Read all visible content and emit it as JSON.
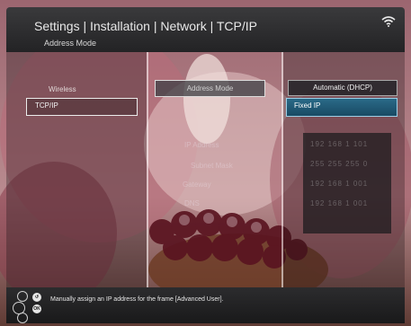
{
  "header": {
    "title": "Settings | Installation | Network | TCP/IP",
    "subtitle": "Address Mode",
    "status_icon": "wifi-icon"
  },
  "column1": {
    "items": [
      {
        "label": "Wireless"
      },
      {
        "label": "TCP/IP",
        "selected": true
      }
    ]
  },
  "column2": {
    "header_label": "Address Mode",
    "field_labels": [
      "IP Address",
      "Subnet Mask",
      "Gateway",
      "DNS"
    ]
  },
  "column3": {
    "options": [
      {
        "label": "Automatic (DHCP)"
      },
      {
        "label": "Fixed IP",
        "highlighted": true
      }
    ],
    "ip_rows": [
      "192  168  1    101",
      "255  255  255  0",
      "192  168  1    001",
      "192  168  1    001"
    ]
  },
  "footer": {
    "hint": "Manually assign an IP address for the frame [Advanced User].",
    "buttons": [
      "back-button",
      "ok-button"
    ],
    "ok_label": "OK"
  },
  "colors": {
    "highlight": "#1e5e7e",
    "header": "#2e2e30"
  }
}
